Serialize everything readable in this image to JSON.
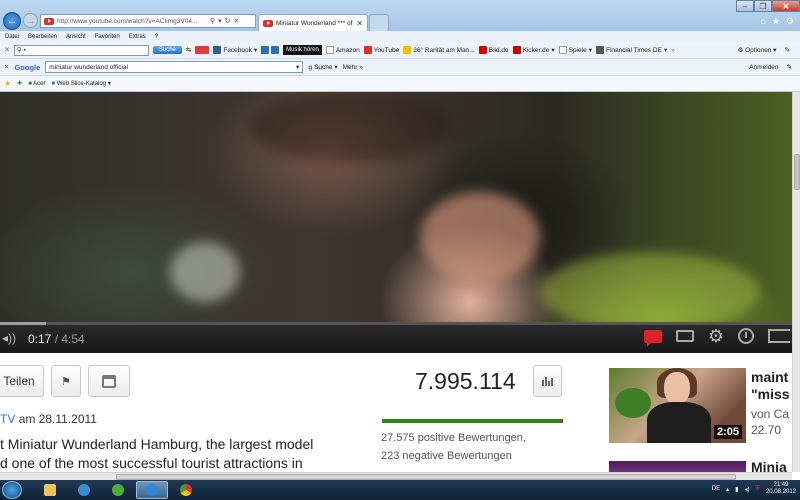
{
  "browser": {
    "address_url": "http://www.youtube.com/watch?v=ACIimg3V04...",
    "tab_title": "Miniatur Wunderland *** of...",
    "menu": [
      "Datei",
      "Bearbeiten",
      "Ansicht",
      "Favoriten",
      "Extras",
      "?"
    ],
    "toolbar": {
      "search_value": "•",
      "search_button": "Suche",
      "musik_label": "Musik hören",
      "optionen": "Optionen",
      "favorites": [
        "Facebook",
        "Amazon",
        "YouTube",
        "26° Rarität am Man...",
        "Bild.de",
        "Kicker.de",
        "Spiele",
        "Financial Times DE"
      ]
    },
    "google_bar": {
      "logo": "Google",
      "query": "miniatur wunderland official",
      "suche": "Suche",
      "mehr": "Mehr »",
      "anmelden": "Anmelden"
    },
    "strip": {
      "acer": "Acer",
      "web_slice": "Web Slice-Katalog"
    }
  },
  "player": {
    "current_time": "0:17",
    "total_time": "/ 4:54",
    "progress": 0.058
  },
  "video_page": {
    "share_label": "Teilen",
    "uploader_channel": "TV",
    "upload_date": "am 28.11.2011",
    "description_lines": [
      "t Miniatur Wunderland Hamburg, the largest model",
      "d one of the most successful tourist attractions in"
    ],
    "view_count": "7.995.114",
    "like_ratio": 0.992,
    "positive": "27.575 positive Bewertungen,",
    "negative": "223 negative Bewertungen"
  },
  "related": {
    "title_lines": [
      "maint",
      "\"miss"
    ],
    "uploader": "von Ca",
    "views": "22.70",
    "duration": "2:05",
    "next_title": "Minia"
  },
  "taskbar": {
    "lang": "DE",
    "time": "21:49",
    "date": "20.08.2012"
  },
  "colors": {
    "like_green": "#2a8a16",
    "dislike_red": "#cc0000",
    "yt_red": "#e52d27",
    "link_blue": "#1b7fcc"
  }
}
